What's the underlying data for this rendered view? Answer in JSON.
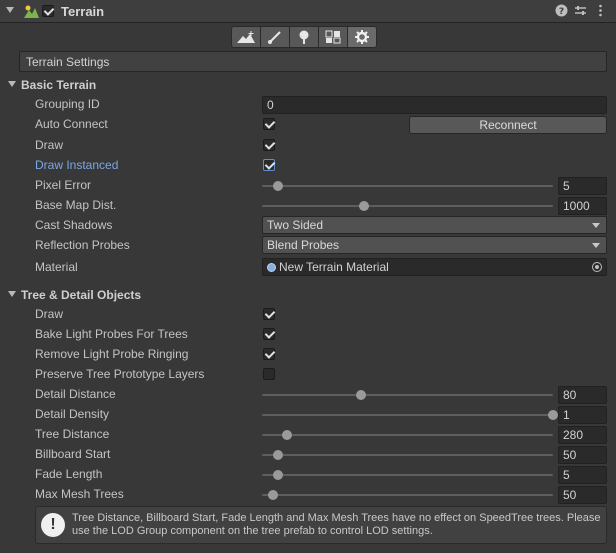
{
  "component": {
    "title": "Terrain",
    "enabled": true
  },
  "toolbar": {
    "tools": [
      "raise-lower-terrain-icon",
      "paint-brush-icon",
      "tree-icon",
      "detail-grass-icon",
      "settings-gear-icon"
    ],
    "active": "settings-gear-icon"
  },
  "settings_title": "Terrain Settings",
  "basic_terrain": {
    "header": "Basic Terrain",
    "grouping_id_label": "Grouping ID",
    "grouping_id_value": "0",
    "auto_connect_label": "Auto Connect",
    "auto_connect": true,
    "reconnect_label": "Reconnect",
    "draw_label": "Draw",
    "draw": true,
    "draw_instanced_label": "Draw Instanced",
    "draw_instanced": true,
    "pixel_error_label": "Pixel Error",
    "pixel_error": "5",
    "pixel_error_fraction": 0.04,
    "base_map_label": "Base Map Dist.",
    "base_map_dist": "1000",
    "base_map_fraction": 0.34,
    "cast_shadows_label": "Cast Shadows",
    "cast_shadows": "Two Sided",
    "reflection_probes_label": "Reflection Probes",
    "reflection_probes": "Blend Probes",
    "material_label": "Material",
    "material": "New Terrain Material"
  },
  "tree_detail": {
    "header": "Tree & Detail Objects",
    "draw_label": "Draw",
    "draw": true,
    "bake_light_probes_label": "Bake Light Probes For Trees",
    "bake_light_probes": true,
    "remove_ringing_label": "Remove Light Probe Ringing",
    "remove_ringing": true,
    "preserve_layers_label": "Preserve Tree Prototype Layers",
    "preserve_layers": false,
    "sliders": [
      {
        "label": "Detail Distance",
        "value": "80",
        "fraction": 0.33
      },
      {
        "label": "Detail Density",
        "value": "1",
        "fraction": 1.0
      },
      {
        "label": "Tree Distance",
        "value": "280",
        "fraction": 0.07
      },
      {
        "label": "Billboard Start",
        "value": "50",
        "fraction": 0.04
      },
      {
        "label": "Fade Length",
        "value": "5",
        "fraction": 0.04
      },
      {
        "label": "Max Mesh Trees",
        "value": "50",
        "fraction": 0.02
      }
    ]
  },
  "help_text": "Tree Distance, Billboard Start, Fade Length and Max Mesh Trees have no effect on SpeedTree trees. Please use the LOD Group component on the tree prefab to control LOD settings."
}
